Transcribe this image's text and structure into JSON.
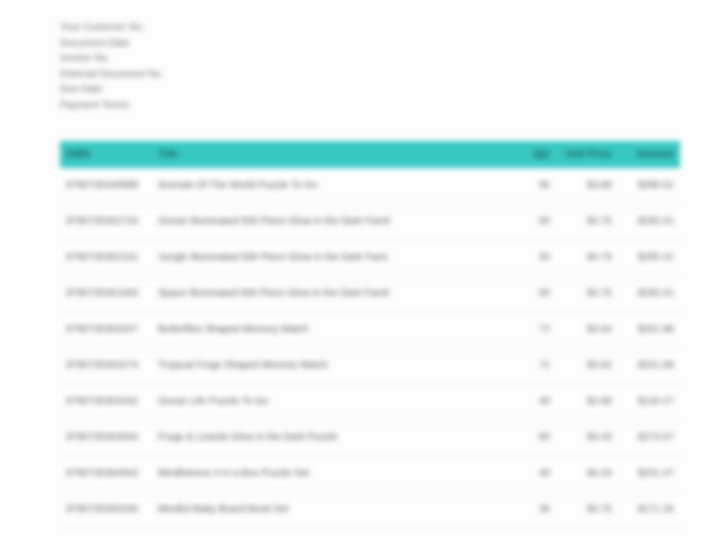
{
  "meta_labels": [
    "Your Customer No.",
    "Document Date",
    "Invoice No.",
    "External Document No.",
    "Due Date",
    "Payment Terms"
  ],
  "columns": {
    "isbn": "ISBN",
    "title": "Title",
    "qty": "Qty",
    "unit_price": "Unit Price",
    "amount": "Amount"
  },
  "rows": [
    {
      "isbn": "9780735349988",
      "title": "Animals Of The World Puzzle To Go",
      "qty": "96",
      "unit_price": "$3.88",
      "amount": "$398.51"
    },
    {
      "isbn": "9780735362734",
      "title": "Ocean Illuminated 500 Piece Glow in the Dark Famil",
      "qty": "60",
      "unit_price": "$4.76",
      "amount": "$285.41"
    },
    {
      "isbn": "9780735362161",
      "title": "Jungle Illuminated 500 Piece Glow in the Dark Fami",
      "qty": "60",
      "unit_price": "$4.76",
      "amount": "$285.41"
    },
    {
      "isbn": "9780735361683",
      "title": "Space Illuminated 500 Piece Glow in the Dark Famil",
      "qty": "60",
      "unit_price": "$4.76",
      "amount": "$285.41"
    },
    {
      "isbn": "9780735363267",
      "title": "Butterflies Shaped Memory Match",
      "qty": "72",
      "unit_price": "$3.64",
      "amount": "$261.88"
    },
    {
      "isbn": "9780735363274",
      "title": "Tropical Frogs Shaped Memory Match",
      "qty": "72",
      "unit_price": "$3.64",
      "amount": "$261.88"
    },
    {
      "isbn": "9780735363342",
      "title": "Ocean Life Puzzle To Go",
      "qty": "48",
      "unit_price": "$2.88",
      "amount": "$134.27"
    },
    {
      "isbn": "9780735363694",
      "title": "Frogs & Lizards Glow in the Dark Puzzle",
      "qty": "80",
      "unit_price": "$3.43",
      "amount": "$273.67"
    },
    {
      "isbn": "9780735364943",
      "title": "Mindfulness 4 in a Box Puzzle Set",
      "qty": "48",
      "unit_price": "$4.20",
      "amount": "$201.47"
    },
    {
      "isbn": "9780735365346",
      "title": "Mindful Baby Board Book Set",
      "qty": "36",
      "unit_price": "$4.76",
      "amount": "$171.26"
    }
  ]
}
